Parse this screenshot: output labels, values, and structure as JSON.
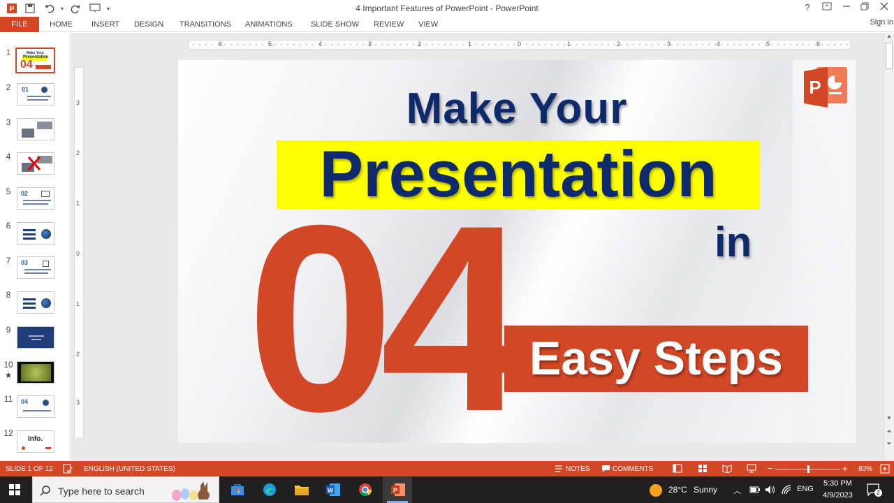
{
  "window": {
    "title": "4 Important Features of PowerPoint - PowerPoint",
    "help": "?",
    "sign_in": "Sign in"
  },
  "ribbon": {
    "file_tab": "FILE",
    "tabs": [
      "HOME",
      "INSERT",
      "DESIGN",
      "TRANSITIONS",
      "ANIMATIONS",
      "SLIDE SHOW",
      "REVIEW",
      "VIEW"
    ]
  },
  "ruler": {
    "h_labels": [
      "6",
      "5",
      "4",
      "3",
      "2",
      "1",
      "0",
      "1",
      "2",
      "3",
      "4",
      "5",
      "6"
    ],
    "v_labels": [
      "3",
      "2",
      "1",
      "0",
      "1",
      "2",
      "3"
    ]
  },
  "thumbnails": {
    "numbers": [
      "1",
      "2",
      "3",
      "4",
      "5",
      "6",
      "7",
      "8",
      "9",
      "10",
      "11",
      "12"
    ],
    "star": "★",
    "t1_top": "Make Your",
    "t1_mid": "Presentation",
    "t1_num": "04",
    "t2_num": "01",
    "t5_num": "02",
    "t7_num": "03",
    "t11_num": "04",
    "t12_text": "Info."
  },
  "slide": {
    "line1": "Make Your",
    "line2": "Presentation",
    "line3": "in",
    "big_number": "04",
    "steps": "Easy Steps"
  },
  "status": {
    "slide_info": "SLIDE 1 OF 12",
    "language": "ENGLISH (UNITED STATES)",
    "notes": "NOTES",
    "comments": "COMMENTS",
    "zoom": "80%",
    "zoom_level": 0.5
  },
  "taskbar": {
    "search_placeholder": "Type here to search",
    "weather_temp": "28°C",
    "weather_desc": "Sunny",
    "lang": "ENG",
    "time": "5:30 PM",
    "date": "4/9/2023",
    "notif_count": "2"
  },
  "colors": {
    "accent": "#d24726",
    "navy": "#0e2a6a",
    "highlight": "#ffff00"
  }
}
